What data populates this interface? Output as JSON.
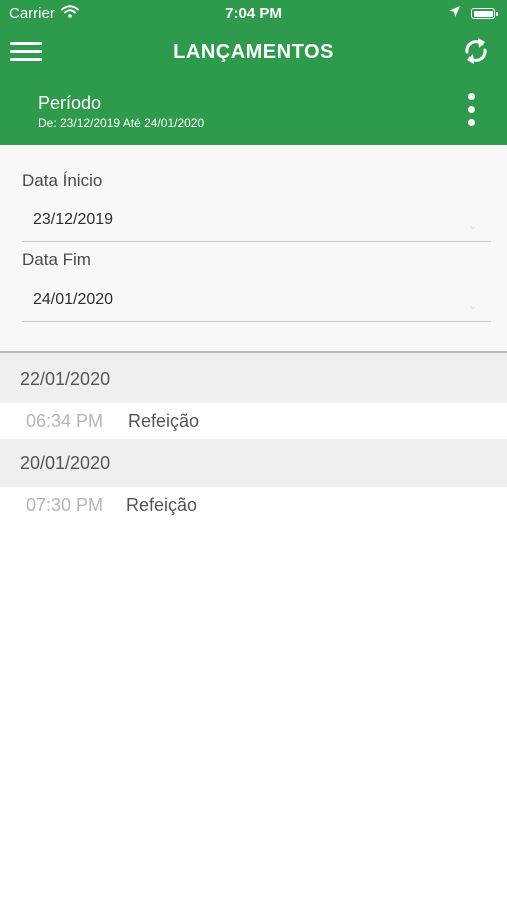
{
  "status_bar": {
    "carrier": "Carrier",
    "time": "7:04 PM",
    "icons": [
      "wifi-icon",
      "location-arrow-icon",
      "battery-icon"
    ],
    "battery_level": 1.0
  },
  "header": {
    "title": "LANÇAMENTOS",
    "menu_icon": "hamburger-icon",
    "refresh_icon": "refresh-icon",
    "more_icon": "more-vertical-icon",
    "period_label": "Período",
    "period_range": "De: 23/12/2019 Até 24/01/2020",
    "background_color": "#2e9a4c"
  },
  "filters": {
    "start": {
      "label": "Data Ínicio",
      "value": "23/12/2019"
    },
    "end": {
      "label": "Data Fim",
      "value": "24/01/2020"
    }
  },
  "sections": [
    {
      "date": "22/01/2020",
      "entries": [
        {
          "time": "06:34 PM",
          "description": "Refeição"
        }
      ]
    },
    {
      "date": "20/01/2020",
      "entries": [
        {
          "time": "07:30 PM",
          "description": "Refeição"
        }
      ]
    }
  ]
}
